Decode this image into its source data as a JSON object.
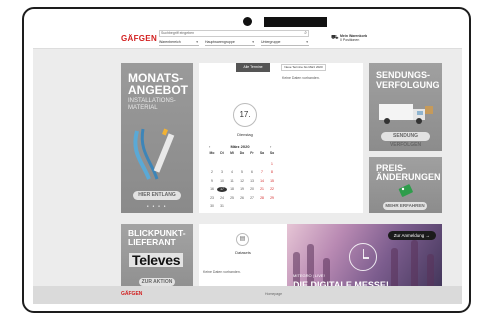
{
  "header": {
    "logo": "GÄFGEN",
    "search": {
      "placeholder": "Suchbegriff eingeben"
    },
    "filters": [
      "Warenbereich",
      "Hauptwarengruppe",
      "Untergruppe"
    ],
    "cart": {
      "title": "Mein Warenkorb",
      "count": "0 Positionen"
    }
  },
  "tiles": {
    "monatsangebot": {
      "title_line1": "MONATS-",
      "title_line2": "ANGEBOT",
      "sub1": "INSTALLATIONS-",
      "sub2": "MATERIAL",
      "button": "HIER ENTLANG"
    },
    "sendung": {
      "title_line1": "SENDUNGS-",
      "title_line2": "VERFOLGUNG",
      "button": "SENDUNG VERFOLGEN"
    },
    "preis": {
      "title_line1": "PREIS-",
      "title_line2": "ÄNDERUNGEN",
      "button": "MEHR ERFAHREN"
    },
    "blickpunkt": {
      "title_line1": "BLICKPUNKT-",
      "title_line2": "LIEFERANT",
      "brand": "Televes",
      "button": "ZUR AKTION"
    }
  },
  "calendar": {
    "all_button": "Alle Termine",
    "date_button": "Neue Termine bis März 2020",
    "no_data": "Keine Daten vorhanden.",
    "day": "17.",
    "weekday": "Dienstag",
    "month": "März 2020",
    "prev": "‹",
    "next": "›",
    "headers": [
      "Mo",
      "Di",
      "Mi",
      "Do",
      "Fr",
      "Sa",
      "So"
    ],
    "weeks": [
      [
        "",
        "",
        "",
        "",
        "",
        "",
        "1"
      ],
      [
        "2",
        "3",
        "4",
        "5",
        "6",
        "7",
        "8"
      ],
      [
        "9",
        "10",
        "11",
        "12",
        "13",
        "14",
        "15"
      ],
      [
        "16",
        "17",
        "18",
        "19",
        "20",
        "21",
        "22"
      ],
      [
        "23",
        "24",
        "25",
        "26",
        "27",
        "28",
        "29"
      ],
      [
        "30",
        "31",
        "",
        "",
        "",
        "",
        ""
      ]
    ],
    "today": "17"
  },
  "datasets": {
    "label": "Datasets",
    "no_data": "Keine Daten vorhanden."
  },
  "event": {
    "register": "Zur Anmeldung →",
    "small": "MITEGRO | LIVE!",
    "big": "DIE DIGITALE MESSE!"
  },
  "footer": {
    "logo": "GÄFGEN",
    "link": "Homepage"
  }
}
